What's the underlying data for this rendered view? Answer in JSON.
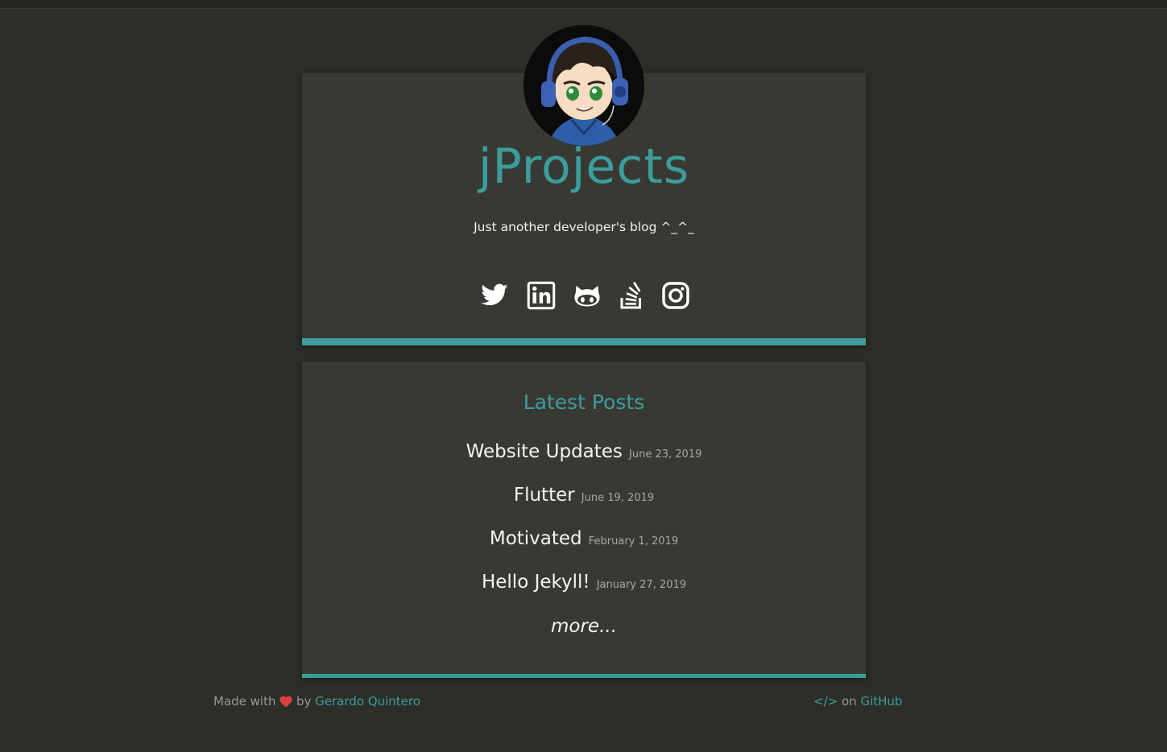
{
  "site": {
    "title": "jProjects",
    "tagline": "Just another developer's blog ^_^_"
  },
  "social": [
    {
      "icon": "twitter-icon",
      "label": "Twitter"
    },
    {
      "icon": "linkedin-icon",
      "label": "LinkedIn"
    },
    {
      "icon": "github-icon",
      "label": "GitHub"
    },
    {
      "icon": "stackoverflow-icon",
      "label": "Stack Overflow"
    },
    {
      "icon": "instagram-icon",
      "label": "Instagram"
    }
  ],
  "posts_section": {
    "heading": "Latest Posts",
    "posts": [
      {
        "title": "Website Updates",
        "date": "June 23, 2019"
      },
      {
        "title": "Flutter",
        "date": "June 19, 2019"
      },
      {
        "title": "Motivated",
        "date": "February 1, 2019"
      },
      {
        "title": "Hello Jekyll!",
        "date": "January 27, 2019"
      }
    ],
    "more_label": "more..."
  },
  "footer": {
    "made_with": "Made with",
    "by": "by",
    "author": "Gerardo Quintero",
    "code_symbol": "</>",
    "on": "on",
    "github": "GitHub"
  },
  "colors": {
    "accent": "#3b9e9d",
    "background": "#2d2d29",
    "card": "#393934",
    "heart": "#d9423f"
  }
}
